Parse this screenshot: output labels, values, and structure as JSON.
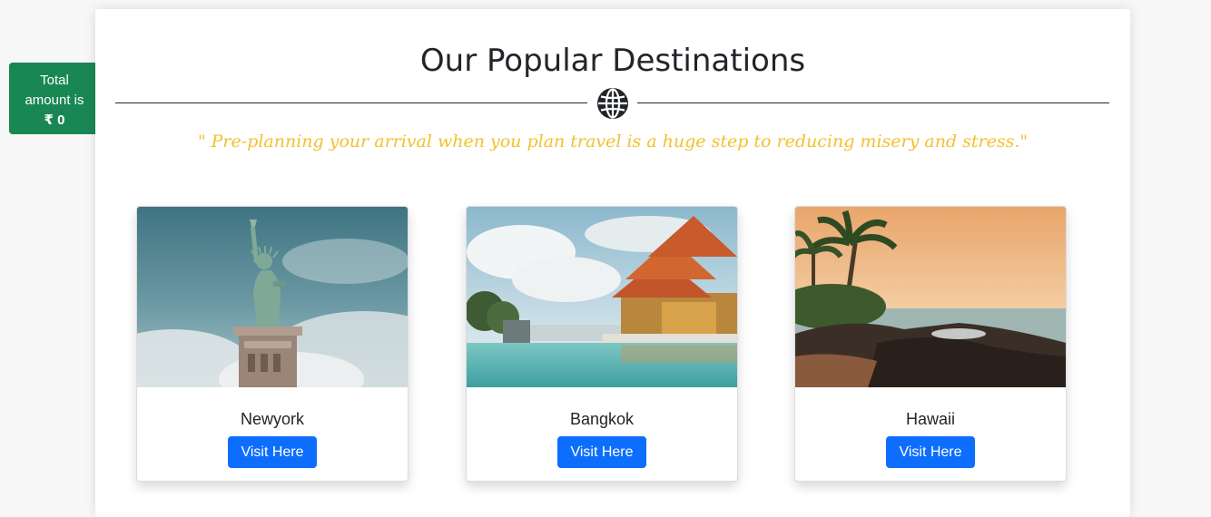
{
  "total": {
    "line1": "Total",
    "line2": "amount is",
    "amount": "₹ 0",
    "color": "#198754"
  },
  "header": {
    "title": "Our Popular Destinations",
    "divider_icon": "globe-icon",
    "quote": "\" Pre-planning your arrival when you plan travel is a huge step to reducing misery and stress.\"",
    "quote_color": "#f2c12e"
  },
  "destinations": [
    {
      "name": "Newyork",
      "button_label": "Visit Here",
      "image": "statue-of-liberty-photo"
    },
    {
      "name": "Bangkok",
      "button_label": "Visit Here",
      "image": "thai-temple-photo"
    },
    {
      "name": "Hawaii",
      "button_label": "Visit Here",
      "image": "tropical-beach-photo"
    }
  ],
  "accent": "#0d6efd"
}
